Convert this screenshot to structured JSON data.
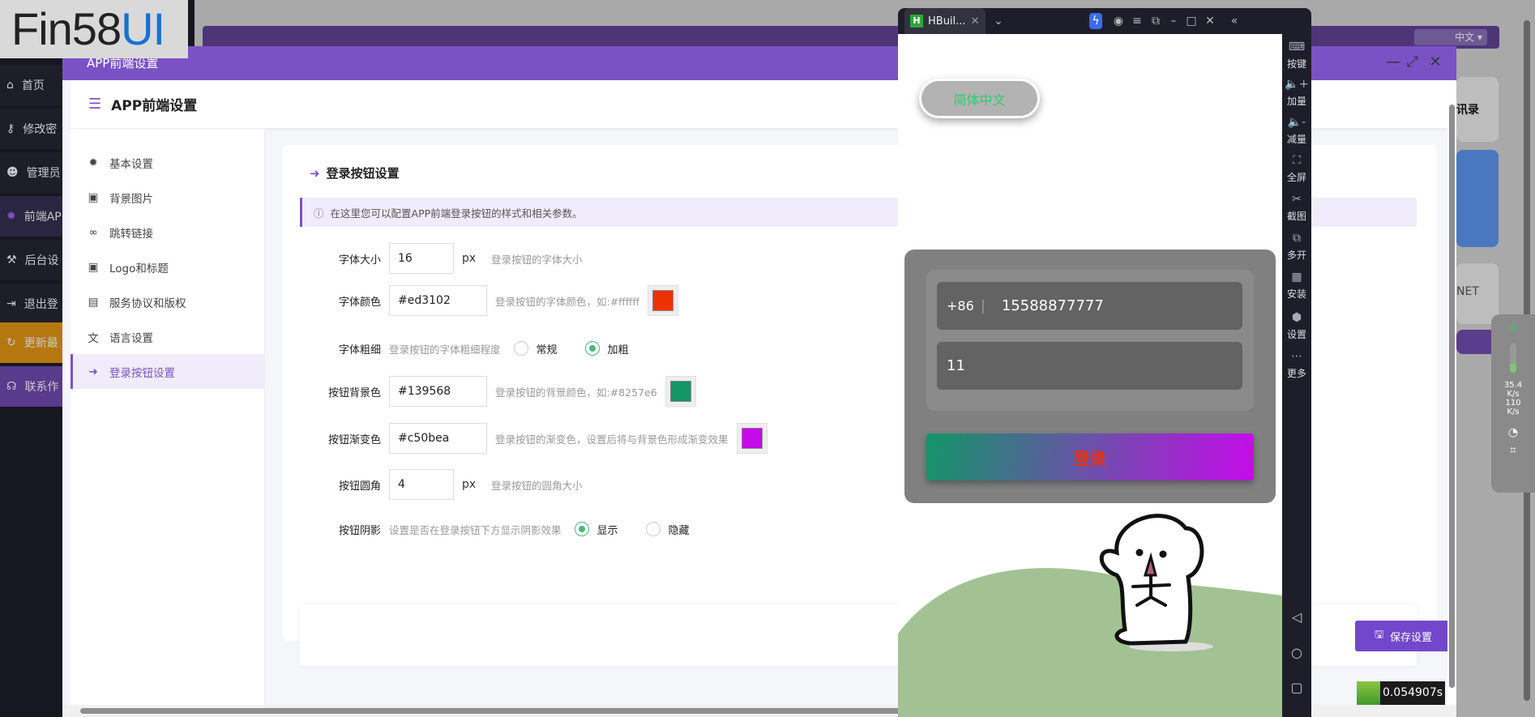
{
  "logo": {
    "text_dark": "Fin58",
    "text_blue": "UI"
  },
  "bg_sidebar": [
    {
      "icon": "home-icon",
      "label": "首页"
    },
    {
      "icon": "key-icon",
      "label": "修改密"
    },
    {
      "icon": "users-icon",
      "label": "管理员"
    },
    {
      "icon": "gear-icon",
      "label": "前端AP"
    },
    {
      "icon": "wrench-icon",
      "label": "后台设"
    },
    {
      "icon": "logout-icon",
      "label": "退出登"
    },
    {
      "icon": "refresh-icon",
      "label": "更新最"
    },
    {
      "icon": "headset-icon",
      "label": "联系作"
    }
  ],
  "bg_right": {
    "card1": "讯录",
    "card2": "NET",
    "lang": "中文"
  },
  "modal": {
    "header_title": "APP前端设置",
    "panel_title": "APP前端设置",
    "nav": [
      {
        "icon": "gear-icon",
        "label": "基本设置"
      },
      {
        "icon": "image-icon",
        "label": "背景图片"
      },
      {
        "icon": "link-icon",
        "label": "跳转链接"
      },
      {
        "icon": "image-icon",
        "label": "Logo和标题"
      },
      {
        "icon": "file-icon",
        "label": "服务协议和版权"
      },
      {
        "icon": "translate-icon",
        "label": "语言设置"
      },
      {
        "icon": "sign-in-icon",
        "label": "登录按钮设置",
        "active": true
      }
    ],
    "card_title": "登录按钮设置",
    "info": "在这里您可以配置APP前端登录按钮的样式和相关参数。",
    "form": {
      "font_size": {
        "label": "字体大小",
        "value": "16",
        "unit": "px",
        "hint": "登录按钮的字体大小"
      },
      "font_color": {
        "label": "字体颜色",
        "value": "#ed3102",
        "hint": "登录按钮的字体颜色，如:#ffffff",
        "swatch": "#ed3102"
      },
      "font_weight": {
        "label": "字体粗细",
        "hint": "登录按钮的字体粗细程度",
        "options": [
          "常规",
          "加粗"
        ],
        "selected": "加粗"
      },
      "bg_color": {
        "label": "按钮背景色",
        "value": "#139568",
        "hint": "登录按钮的背景颜色，如:#8257e6",
        "swatch": "#139568"
      },
      "gradient": {
        "label": "按钮渐变色",
        "value": "#c50bea",
        "hint": "登录按钮的渐变色，设置后将与背景色形成渐变效果",
        "swatch": "#c50bea"
      },
      "radius": {
        "label": "按钮圆角",
        "value": "4",
        "unit": "px",
        "hint": "登录按钮的圆角大小"
      },
      "shadow": {
        "label": "按钮阴影",
        "hint": "设置是否在登录按钮下方显示阴影效果",
        "options": [
          "显示",
          "隐藏"
        ],
        "selected": "显示"
      }
    },
    "save_label": "保存设置"
  },
  "phone": {
    "tab_title": "HBuil...",
    "lang_button": "简体中文",
    "country_code": "+86",
    "phone_value": "15588877777",
    "password_value": "11",
    "login_label": "登录",
    "tools": [
      "按键",
      "加量",
      "减量",
      "全屏",
      "截图",
      "多开",
      "安装",
      "设置",
      "更多"
    ]
  },
  "float_widget": {
    "up": "35.4",
    "up_unit": "K/s",
    "down": "110",
    "down_unit": "K/s"
  },
  "timer": "0.054907s",
  "colors": {
    "accent": "#7b52c5",
    "radio": "#4cb77a"
  }
}
